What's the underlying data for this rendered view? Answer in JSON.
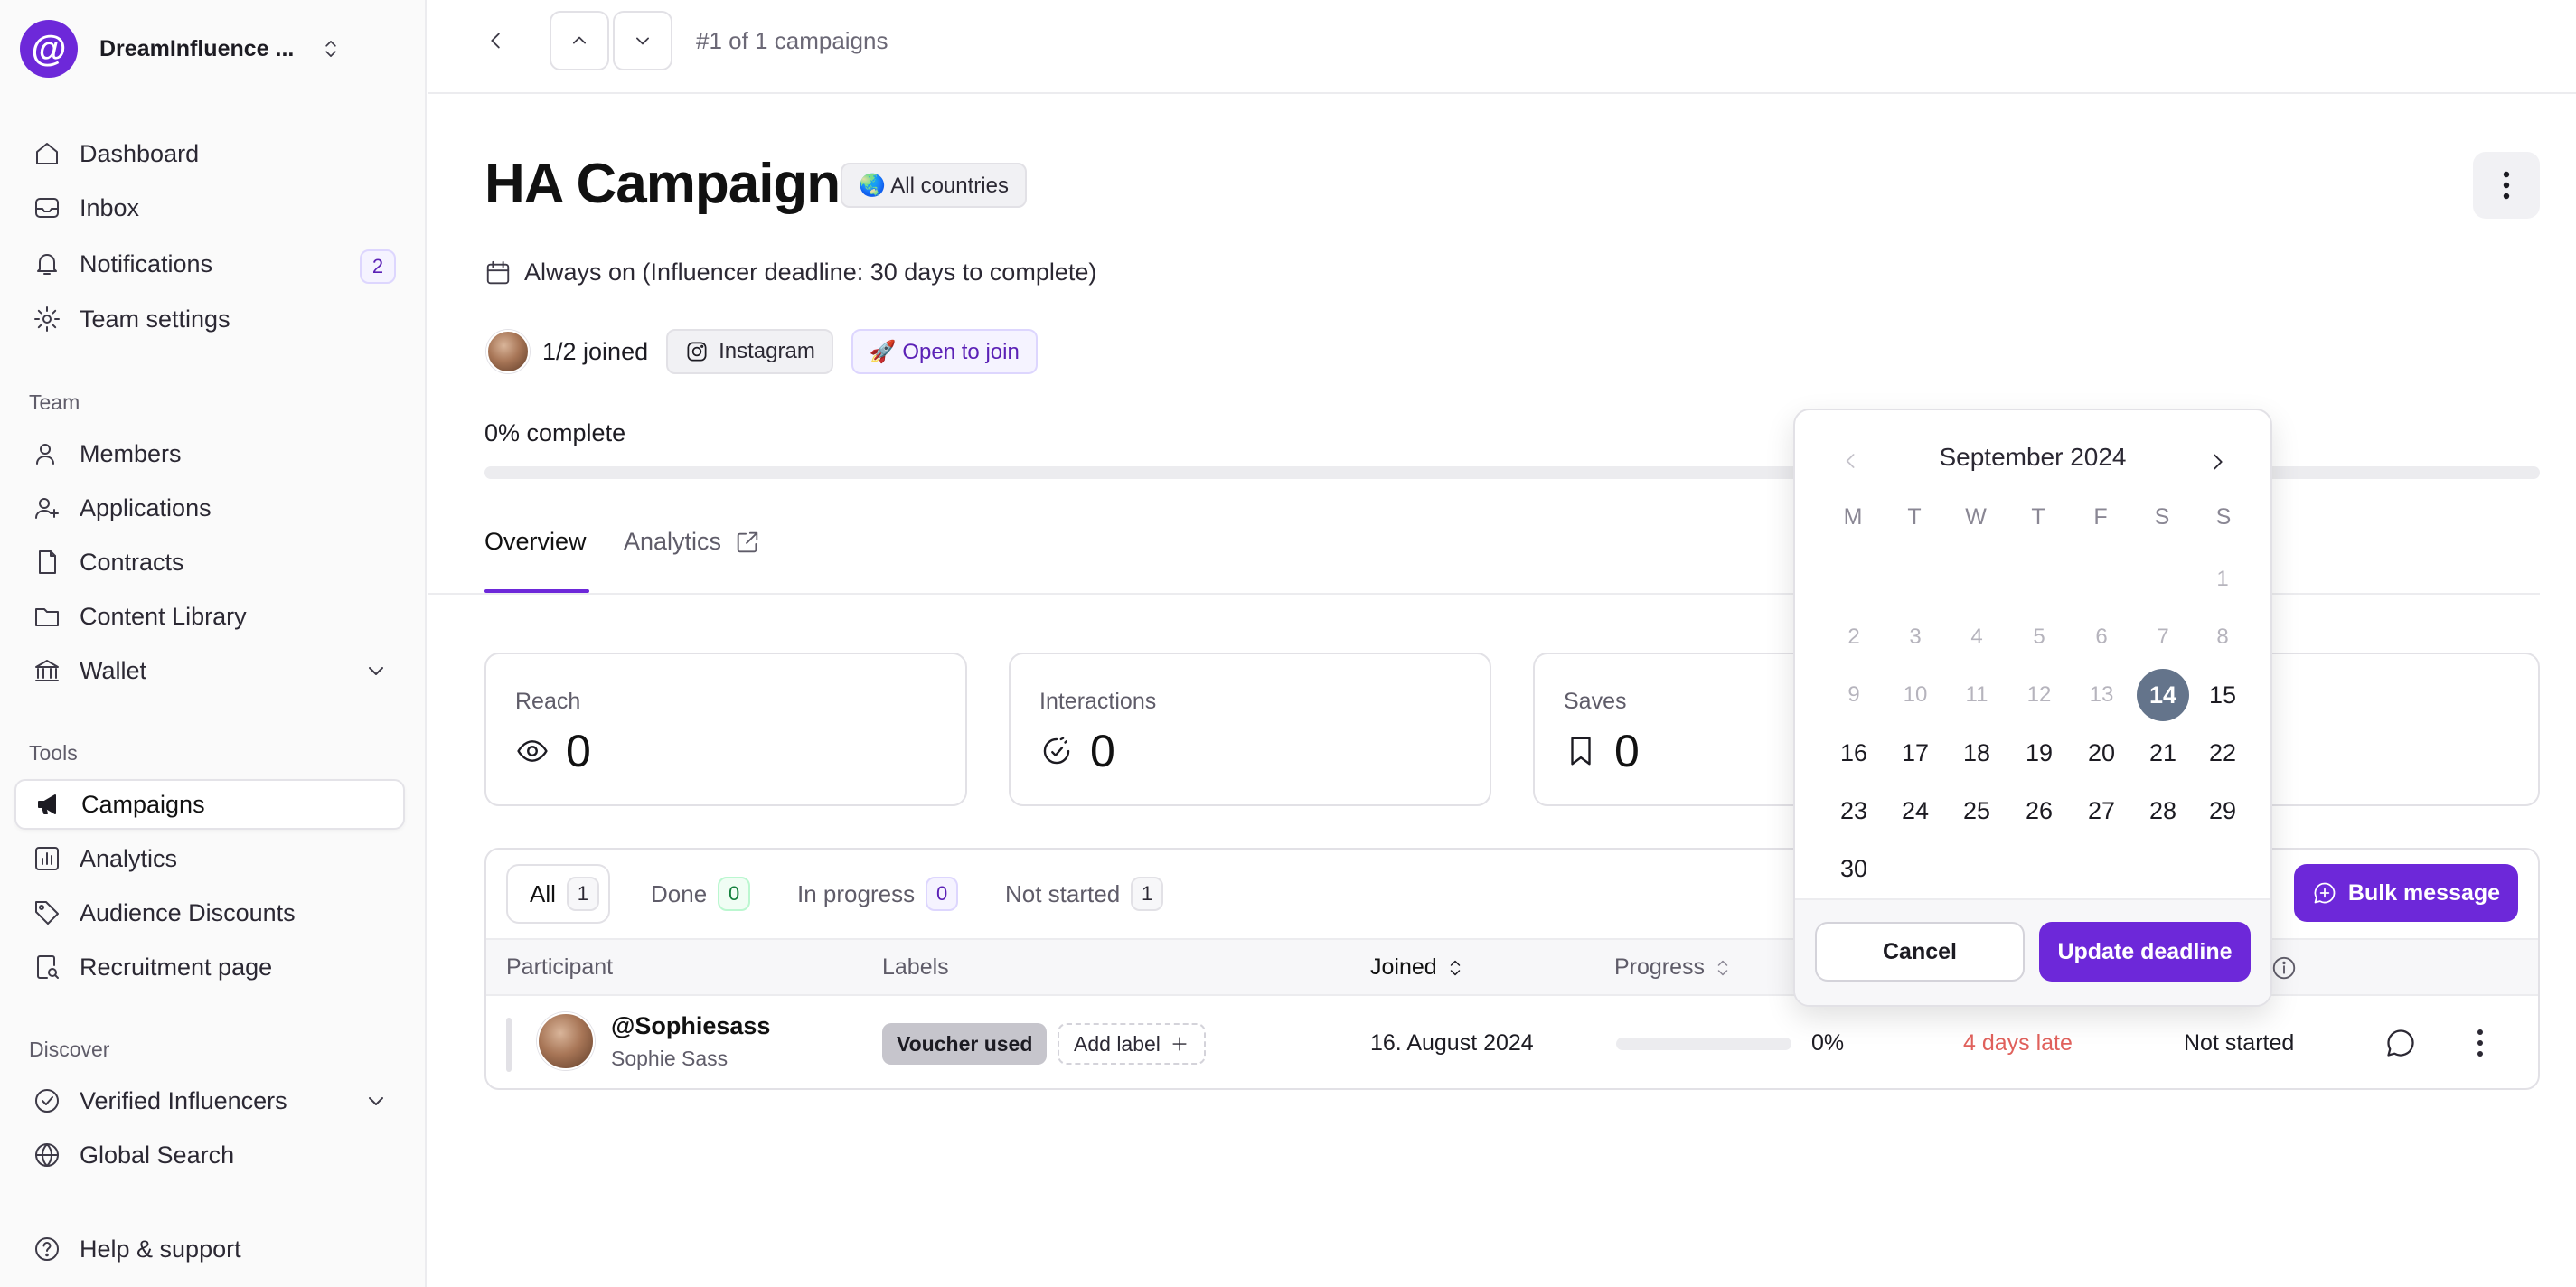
{
  "sidebar": {
    "org_name": "DreamInfluence ...",
    "nav_main": [
      {
        "label": "Dashboard",
        "icon": "home-icon"
      },
      {
        "label": "Inbox",
        "icon": "inbox-icon"
      },
      {
        "label": "Notifications",
        "icon": "bell-icon",
        "badge": "2"
      },
      {
        "label": "Team settings",
        "icon": "gear-icon"
      }
    ],
    "team_label": "Team",
    "nav_team": [
      {
        "label": "Members",
        "icon": "user-icon"
      },
      {
        "label": "Applications",
        "icon": "user-plus-icon"
      },
      {
        "label": "Contracts",
        "icon": "document-icon"
      },
      {
        "label": "Content Library",
        "icon": "folder-icon"
      },
      {
        "label": "Wallet",
        "icon": "bank-icon"
      }
    ],
    "tools_label": "Tools",
    "nav_tools": [
      {
        "label": "Campaigns",
        "icon": "megaphone-icon",
        "active": true
      },
      {
        "label": "Analytics",
        "icon": "chart-icon"
      },
      {
        "label": "Audience Discounts",
        "icon": "tag-icon"
      },
      {
        "label": "Recruitment page",
        "icon": "page-search-icon"
      }
    ],
    "discover_label": "Discover",
    "nav_discover": [
      {
        "label": "Verified Influencers",
        "icon": "verified-icon"
      },
      {
        "label": "Global Search",
        "icon": "globe-icon"
      }
    ],
    "help_label": "Help & support"
  },
  "topbar": {
    "counter": "#1 of 1 campaigns"
  },
  "campaign": {
    "title": "HA Campaign",
    "countries_chip": "🌏 All countries",
    "deadline_text": "Always on (Influencer deadline: 30 days to complete)",
    "joined": "1/2 joined",
    "platform": "Instagram",
    "status_chip": "🚀 Open to join",
    "progress_label": "0% complete",
    "progress_value": 0
  },
  "tabs": [
    {
      "label": "Overview",
      "active": true
    },
    {
      "label": "Analytics",
      "active": false
    }
  ],
  "stats": [
    {
      "label": "Reach",
      "value": "0",
      "icon": "eye-icon"
    },
    {
      "label": "Interactions",
      "value": "0",
      "icon": "interactions-icon"
    },
    {
      "label": "Saves",
      "value": "0",
      "icon": "bookmark-icon"
    }
  ],
  "filters": [
    {
      "label": "All",
      "count": "1"
    },
    {
      "label": "Done",
      "count": "0"
    },
    {
      "label": "In progress",
      "count": "0"
    },
    {
      "label": "Not started",
      "count": "1"
    }
  ],
  "bulk_message_label": "Bulk message",
  "table": {
    "headers": {
      "participant": "Participant",
      "labels": "Labels",
      "joined": "Joined",
      "progress": "Progress"
    },
    "rows": [
      {
        "handle": "@Sophiesass",
        "name": "Sophie Sass",
        "label": "Voucher used",
        "add_label": "Add label",
        "joined": "16. August 2024",
        "progress": "0%",
        "progress_value": 0,
        "deadline": "4 days late",
        "status": "Not started"
      }
    ]
  },
  "datepicker": {
    "month": "September 2024",
    "weekdays": [
      "M",
      "T",
      "W",
      "T",
      "F",
      "S",
      "S"
    ],
    "selected_day": "14",
    "cancel_label": "Cancel",
    "update_label": "Update deadline"
  },
  "colors": {
    "accent": "#6d28d9",
    "late": "#e0615c",
    "today": "#64748b"
  }
}
